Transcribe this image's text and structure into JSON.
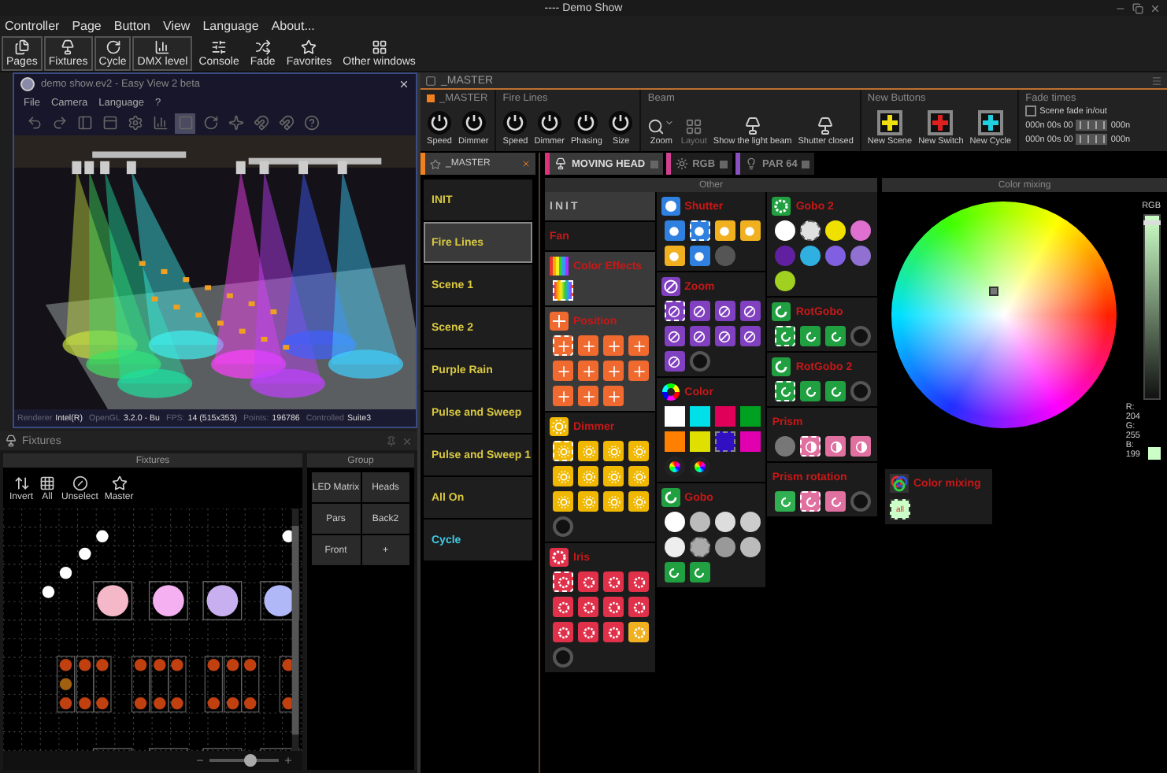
{
  "window": {
    "title": "---- Demo Show"
  },
  "menu": [
    "Controller",
    "Page",
    "Button",
    "View",
    "Language",
    "About..."
  ],
  "toolbar": [
    {
      "kind": "pages",
      "label": "Pages",
      "on": true
    },
    {
      "kind": "fixtures",
      "label": "Fixtures",
      "on": true
    },
    {
      "kind": "cycle",
      "label": "Cycle",
      "on": true
    },
    {
      "kind": "dmx",
      "label": "DMX level",
      "on": true
    },
    {
      "kind": "console",
      "label": "Console",
      "on": false
    },
    {
      "kind": "fade",
      "label": "Fade",
      "on": false
    },
    {
      "kind": "favorites",
      "label": "Favorites",
      "on": false
    },
    {
      "kind": "windows",
      "label": "Other windows",
      "on": false
    }
  ],
  "viewer": {
    "title": "demo show.ev2 - Easy View 2 beta",
    "menu": [
      "File",
      "Camera",
      "Language",
      "?"
    ],
    "tools": [
      {
        "kind": "undo",
        "selected": false
      },
      {
        "kind": "redo",
        "selected": false
      },
      {
        "kind": "panel",
        "selected": false
      },
      {
        "kind": "window",
        "selected": false
      },
      {
        "kind": "settings",
        "selected": false
      },
      {
        "kind": "chart",
        "selected": false
      },
      {
        "kind": "square",
        "selected": true
      },
      {
        "kind": "rotate",
        "selected": false
      },
      {
        "kind": "sparkle",
        "selected": false
      },
      {
        "kind": "magnet",
        "selected": false
      },
      {
        "kind": "magnet",
        "selected": false
      },
      {
        "kind": "help",
        "selected": false
      }
    ],
    "status": [
      {
        "label": "Renderer",
        "value": "Intel(R)"
      },
      {
        "label": "OpenGL",
        "value": "3.2.0 - Bu"
      },
      {
        "label": "FPS:",
        "value": "14 (515x353)"
      },
      {
        "label": "Points:",
        "value": "196786"
      },
      {
        "label": "Controlled",
        "value": "Suite3"
      }
    ]
  },
  "fixtures": {
    "title": "Fixtures",
    "panel_title": "Fixtures",
    "tools": [
      {
        "kind": "invert",
        "label": "Invert"
      },
      {
        "kind": "all",
        "label": "All"
      },
      {
        "kind": "unselect",
        "label": "Unselect"
      },
      {
        "kind": "master",
        "label": "Master"
      }
    ],
    "zoom": {
      "level": 0.6
    },
    "group_title": "Group",
    "groups": [
      "LED Matrix",
      "Heads",
      "Pars",
      "Back2",
      "Front",
      "+"
    ]
  },
  "master_bar": {
    "title": "_MASTER"
  },
  "sections": [
    {
      "title": "_MASTER",
      "color": "#f08020",
      "items": [
        {
          "kind": "knob",
          "label": "Speed"
        },
        {
          "kind": "knob",
          "label": "Dimmer"
        }
      ]
    },
    {
      "title": "Fire Lines",
      "items": [
        {
          "kind": "knob",
          "label": "Speed"
        },
        {
          "kind": "knob",
          "label": "Dimmer"
        },
        {
          "kind": "knob",
          "label": "Phasing"
        },
        {
          "kind": "knob",
          "label": "Size"
        }
      ]
    },
    {
      "title": "Beam",
      "items": [
        {
          "kind": "zoom",
          "label": "Zoom",
          "disabled": false
        },
        {
          "kind": "layout",
          "label": "Layout",
          "disabled": true
        },
        {
          "kind": "beam",
          "label": "Show the light beam",
          "disabled": false
        },
        {
          "kind": "shutter",
          "label": "Shutter closed",
          "disabled": false
        }
      ]
    },
    {
      "title": "New Buttons",
      "items": [
        {
          "kind": "add",
          "label": "New Scene",
          "color": "#f0e010"
        },
        {
          "kind": "add",
          "label": "New Switch",
          "color": "#e02020"
        },
        {
          "kind": "add",
          "label": "New Cycle",
          "color": "#20d0e0"
        }
      ]
    }
  ],
  "fade_times": {
    "title": "Fade times",
    "checkbox": {
      "label": "Scene fade in/out",
      "checked": false
    },
    "rows": [
      {
        "time": "000n 00s 00",
        "end": "000n"
      },
      {
        "time": "000n 00s 00",
        "end": "000n"
      }
    ]
  },
  "page_tab": {
    "title": "_MASTER"
  },
  "scenes": [
    {
      "kind": "scene",
      "label": "INIT",
      "selected": false
    },
    {
      "kind": "scene",
      "label": "Fire Lines",
      "selected": true
    },
    {
      "kind": "scene",
      "label": "Scene 1",
      "selected": false
    },
    {
      "kind": "scene",
      "label": "Scene 2",
      "selected": false
    },
    {
      "kind": "scene",
      "label": "Purple Rain",
      "selected": false
    },
    {
      "kind": "scene",
      "label": "Pulse and Sweep",
      "selected": false
    },
    {
      "kind": "scene",
      "label": "Pulse and Sweep 1",
      "selected": false
    },
    {
      "kind": "scene",
      "label": "All On",
      "selected": false
    },
    {
      "kind": "cycle",
      "label": "Cycle",
      "selected": false
    }
  ],
  "device_tabs": [
    {
      "kind": "head",
      "label": "MOVING HEAD",
      "color": "#e0307a",
      "selected": true
    },
    {
      "kind": "led",
      "label": "RGB",
      "color": "#d04090",
      "selected": false
    },
    {
      "kind": "par",
      "label": "PAR 64",
      "color": "#8a50c0",
      "selected": false
    }
  ],
  "other": {
    "title": "Other",
    "columns": [
      [
        {
          "kind": "label",
          "title": "INIT",
          "selected": true
        },
        {
          "kind": "plain",
          "title": "Fan",
          "selected": false
        },
        {
          "kind": "effects",
          "title": "Color Effects",
          "selected": true,
          "buttons": [
            {
              "kind": "rainbow",
              "selected": true
            }
          ]
        },
        {
          "kind": "position",
          "title": "Position",
          "color": "#f06a30",
          "selected": true,
          "buttons": [
            {
              "kind": "tile",
              "selected": true
            },
            {
              "kind": "tile",
              "selected": false
            },
            {
              "kind": "tile",
              "selected": false
            },
            {
              "kind": "tile",
              "selected": false
            },
            {
              "kind": "tile",
              "selected": false
            },
            {
              "kind": "tile",
              "selected": false
            },
            {
              "kind": "tile",
              "selected": false
            },
            {
              "kind": "tile",
              "selected": false
            },
            {
              "kind": "tile",
              "selected": false
            },
            {
              "kind": "tile",
              "selected": false
            },
            {
              "kind": "tile",
              "selected": false
            }
          ]
        },
        {
          "kind": "dimmer",
          "title": "Dimmer",
          "color": "#f0b800",
          "selected": false,
          "buttons": [
            {
              "kind": "tile",
              "selected": true
            },
            {
              "kind": "tile",
              "selected": false
            },
            {
              "kind": "tile",
              "selected": false
            },
            {
              "kind": "tile",
              "selected": false
            },
            {
              "kind": "tile",
              "selected": false
            },
            {
              "kind": "tile",
              "selected": false
            },
            {
              "kind": "tile",
              "selected": false
            },
            {
              "kind": "tile",
              "selected": false
            },
            {
              "kind": "tile",
              "selected": false
            },
            {
              "kind": "tile",
              "selected": false
            },
            {
              "kind": "tile",
              "selected": false
            },
            {
              "kind": "tile",
              "selected": false
            },
            {
              "kind": "knob",
              "selected": false
            }
          ]
        },
        {
          "kind": "iris",
          "title": "Iris",
          "color": "#e0304a",
          "selected": false,
          "buttons": [
            {
              "kind": "tile",
              "selected": true
            },
            {
              "kind": "tile",
              "selected": false
            },
            {
              "kind": "tile",
              "selected": false
            },
            {
              "kind": "tile",
              "selected": false
            },
            {
              "kind": "tile",
              "selected": false
            },
            {
              "kind": "tile",
              "selected": false
            },
            {
              "kind": "tile",
              "selected": false
            },
            {
              "kind": "tile",
              "selected": false
            },
            {
              "kind": "tile",
              "selected": false
            },
            {
              "kind": "tile",
              "selected": false
            },
            {
              "kind": "tile",
              "selected": false
            },
            {
              "kind": "tile",
              "color": "#f0b020",
              "selected": false
            },
            {
              "kind": "knob",
              "selected": false
            }
          ]
        }
      ],
      [
        {
          "kind": "shutter",
          "title": "Shutter",
          "color": "#3080e0",
          "selected": false,
          "buttons": [
            {
              "kind": "tile",
              "selected": false
            },
            {
              "kind": "tile",
              "selected": true
            },
            {
              "kind": "tile",
              "color": "#f0b020",
              "selected": false
            },
            {
              "kind": "tile",
              "color": "#f0b020",
              "selected": false
            },
            {
              "kind": "tile",
              "color": "#f0b020",
              "selected": false
            },
            {
              "kind": "tile",
              "selected": false
            },
            {
              "kind": "disc",
              "color": "#555555",
              "selected": false
            }
          ]
        },
        {
          "kind": "zoom",
          "title": "Zoom",
          "color": "#8040c0",
          "selected": false,
          "buttons": [
            {
              "kind": "tile",
              "selected": true
            },
            {
              "kind": "tile",
              "selected": false
            },
            {
              "kind": "tile",
              "selected": false
            },
            {
              "kind": "tile",
              "selected": false
            },
            {
              "kind": "tile",
              "selected": false
            },
            {
              "kind": "tile",
              "selected": false
            },
            {
              "kind": "tile",
              "selected": false
            },
            {
              "kind": "tile",
              "selected": false
            },
            {
              "kind": "tile",
              "selected": false
            },
            {
              "kind": "knob",
              "selected": false
            }
          ]
        },
        {
          "kind": "color",
          "title": "Color",
          "selected": false,
          "buttons": [
            {
              "kind": "swatch",
              "color": "#ffffff",
              "selected": false
            },
            {
              "kind": "swatch",
              "color": "#00e0e8",
              "selected": false
            },
            {
              "kind": "swatch",
              "color": "#e0005a",
              "selected": false
            },
            {
              "kind": "swatch",
              "color": "#00a020",
              "selected": false
            },
            {
              "kind": "swatch",
              "color": "#ff8000",
              "selected": false
            },
            {
              "kind": "swatch",
              "color": "#e0e000",
              "selected": false
            },
            {
              "kind": "swatch",
              "color": "#3010c0",
              "selected": true
            },
            {
              "kind": "swatch",
              "color": "#e000b0",
              "selected": false
            },
            {
              "kind": "wheel",
              "selected": false
            },
            {
              "kind": "wheel",
              "selected": false
            }
          ]
        },
        {
          "kind": "gobo",
          "title": "Gobo",
          "color": "#20a040",
          "selected": false,
          "buttons": [
            {
              "kind": "disc",
              "color": "#ffffff",
              "selected": false
            },
            {
              "kind": "disc",
              "color": "#bbbbbb",
              "selected": false
            },
            {
              "kind": "disc",
              "color": "#dddddd",
              "selected": false
            },
            {
              "kind": "disc",
              "color": "#cccccc",
              "selected": false
            },
            {
              "kind": "disc",
              "color": "#eeeeee",
              "selected": false
            },
            {
              "kind": "disc",
              "color": "#aaaaaa",
              "selected": true
            },
            {
              "kind": "disc",
              "color": "#999999",
              "selected": false
            },
            {
              "kind": "disc",
              "color": "#bbbbbb",
              "selected": false
            },
            {
              "kind": "tile",
              "selected": false
            },
            {
              "kind": "tile",
              "selected": false
            }
          ]
        }
      ],
      [
        {
          "kind": "gobo2",
          "title": "Gobo 2",
          "color": "#20a040",
          "selected": false,
          "buttons": [
            {
              "kind": "disc",
              "color": "#ffffff",
              "selected": false
            },
            {
              "kind": "disc",
              "color": "#e0e0e0",
              "selected": true
            },
            {
              "kind": "disc",
              "color": "#f0e000",
              "selected": false
            },
            {
              "kind": "disc",
              "color": "#e070d0",
              "selected": false
            },
            {
              "kind": "disc",
              "color": "#6020a0",
              "selected": false
            },
            {
              "kind": "disc",
              "color": "#30b0e0",
              "selected": false
            },
            {
              "kind": "disc",
              "color": "#8060e0",
              "selected": false
            },
            {
              "kind": "disc",
              "color": "#9070d0",
              "selected": false
            },
            {
              "kind": "disc",
              "color": "#a0d020",
              "selected": false
            }
          ]
        },
        {
          "kind": "rotgobo",
          "title": "RotGobo",
          "color": "#20a040",
          "selected": false,
          "buttons": [
            {
              "kind": "tile",
              "selected": true
            },
            {
              "kind": "tile",
              "selected": false
            },
            {
              "kind": "tile",
              "selected": false
            },
            {
              "kind": "knob",
              "selected": false
            }
          ]
        },
        {
          "kind": "rotgobo",
          "title": "RotGobo 2",
          "color": "#20a040",
          "selected": false,
          "buttons": [
            {
              "kind": "tile",
              "selected": true
            },
            {
              "kind": "tile",
              "selected": false
            },
            {
              "kind": "tile",
              "selected": false
            },
            {
              "kind": "knob",
              "selected": false
            }
          ]
        },
        {
          "kind": "prism",
          "title": "Prism",
          "color": "#e070a0",
          "selected": false,
          "buttons": [
            {
              "kind": "disc",
              "color": "#777777",
              "selected": false
            },
            {
              "kind": "tile",
              "selected": true
            },
            {
              "kind": "tile",
              "selected": false
            },
            {
              "kind": "tile",
              "selected": false
            }
          ]
        },
        {
          "kind": "prism_rotation",
          "title": "Prism rotation",
          "color": "#e070a0",
          "selected": false,
          "buttons": [
            {
              "kind": "tile",
              "color": "#30b050",
              "selected": false
            },
            {
              "kind": "tile",
              "selected": true
            },
            {
              "kind": "tile",
              "selected": false
            },
            {
              "kind": "knob",
              "selected": false
            }
          ]
        }
      ]
    ]
  },
  "color_mixing": {
    "title": "Color mixing",
    "slider_label": "RGB",
    "level": 0.97,
    "readout": [
      "R: 204",
      "G: 255",
      "B: 199"
    ],
    "color": "#ccffc7",
    "group": {
      "title": "Color mixing",
      "button": {
        "label": "all",
        "selected": true
      }
    }
  }
}
